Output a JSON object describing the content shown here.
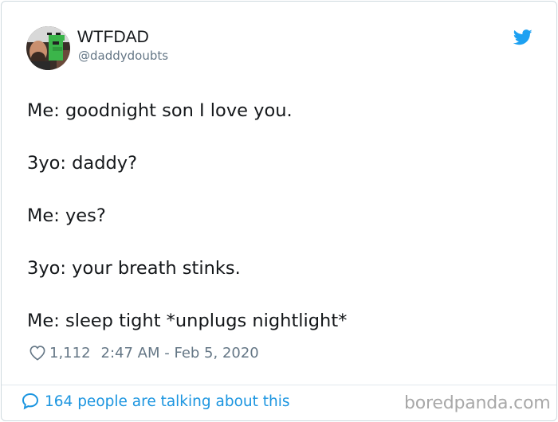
{
  "user": {
    "display_name": "WTFDAD",
    "handle": "@daddydoubts"
  },
  "tweet": {
    "lines": [
      "Me: goodnight son I love you.",
      "3yo: daddy?",
      "Me: yes?",
      "3yo: your breath stinks.",
      "Me: sleep tight *unplugs nightlight*"
    ],
    "likes": "1,112",
    "timestamp": "2:47 AM - Feb 5, 2020",
    "talking": "164 people are talking about this"
  },
  "watermark": "boredpanda.com",
  "icons": {
    "brand": "twitter-bird-icon",
    "like": "heart-icon",
    "reply": "speech-bubble-icon"
  },
  "colors": {
    "accent": "#1da1f2",
    "link": "#1b95e0",
    "text": "#14171a",
    "muted": "#657786"
  }
}
